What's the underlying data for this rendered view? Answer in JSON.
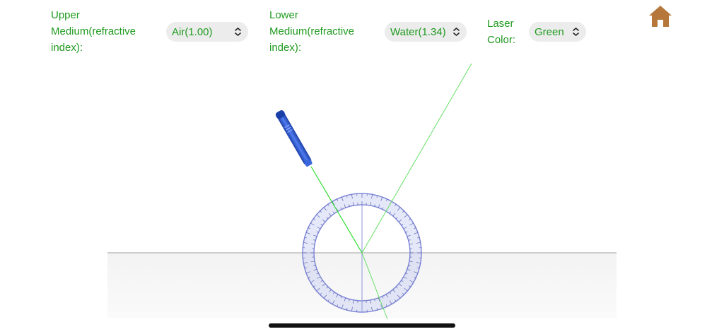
{
  "upper_medium": {
    "label": "Upper Medium(refractive index):",
    "selected": "Air(1.00)"
  },
  "lower_medium": {
    "label": "Lower Medium(refractive index):",
    "selected": "Water(1.34)"
  },
  "laser_color": {
    "label": "Laser Color:",
    "selected": "Green"
  },
  "colors": {
    "label_text": "#1f9a1f",
    "laser_beam": "#33dd33",
    "home_icon": "#b5783a",
    "laser_body": "#2d5bd6",
    "protractor": "#7d86d6"
  },
  "icons": {
    "home": "home-icon",
    "dropdown": "chevron-up-down-icon"
  }
}
